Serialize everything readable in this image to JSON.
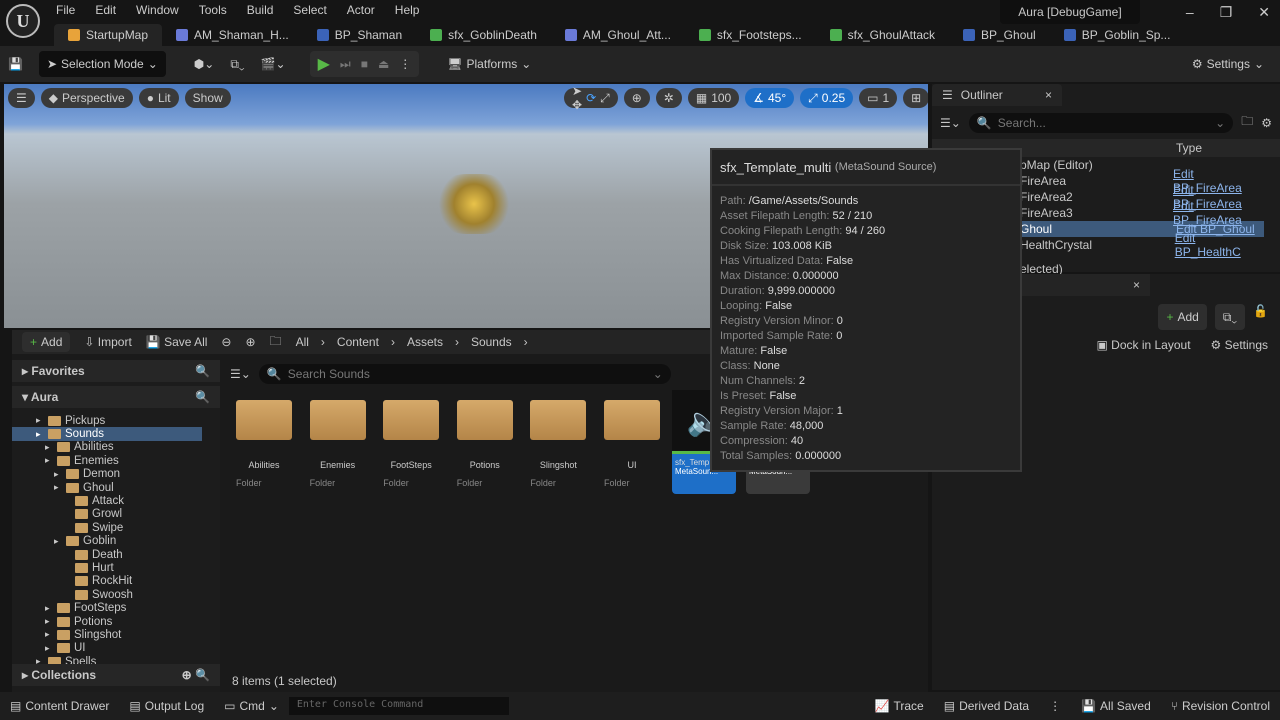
{
  "app": {
    "window_title": "Aura [DebugGame]",
    "menu": [
      "File",
      "Edit",
      "Window",
      "Tools",
      "Build",
      "Select",
      "Actor",
      "Help"
    ]
  },
  "tabs": [
    {
      "label": "StartupMap",
      "icon": "level-icon"
    },
    {
      "label": "AM_Shaman_H...",
      "icon": "anim-montage-icon"
    },
    {
      "label": "BP_Shaman",
      "icon": "blueprint-icon"
    },
    {
      "label": "sfx_GoblinDeath",
      "icon": "sound-icon"
    },
    {
      "label": "AM_Ghoul_Att...",
      "icon": "anim-montage-icon"
    },
    {
      "label": "sfx_Footsteps...",
      "icon": "sound-icon"
    },
    {
      "label": "sfx_GhoulAttack",
      "icon": "sound-icon"
    },
    {
      "label": "BP_Ghoul",
      "icon": "blueprint-icon"
    },
    {
      "label": "BP_Goblin_Sp...",
      "icon": "blueprint-icon"
    }
  ],
  "toolbar": {
    "selection_mode": "Selection Mode",
    "platforms": "Platforms",
    "settings": "Settings"
  },
  "viewport": {
    "perspective": "Perspective",
    "lit": "Lit",
    "show": "Show",
    "grid_snap": "100",
    "rot_snap": "45°",
    "scale_snap": "0.25",
    "camera_speed": "1"
  },
  "outliner": {
    "title": "Outliner",
    "search_placeholder": "Search...",
    "type_header": "Type",
    "rows": [
      {
        "label": "pMap (Editor)",
        "type": ""
      },
      {
        "label": "FireArea",
        "type": "Edit BP_FireArea"
      },
      {
        "label": "FireArea2",
        "type": "Edit BP_FireArea"
      },
      {
        "label": "FireArea3",
        "type": "Edit BP_FireArea"
      },
      {
        "label": "Ghoul",
        "type": "Edit BP_Ghoul",
        "selected": true
      },
      {
        "label": "HealthCrystal",
        "type": "Edit BP_HealthC"
      }
    ],
    "footer": "elected)"
  },
  "details": {
    "add": "Add",
    "dock": "Dock in Layout",
    "settings": "Settings"
  },
  "content_browser": {
    "add": "Add",
    "import": "Import",
    "save_all": "Save All",
    "breadcrumb": [
      "All",
      "Content",
      "Assets",
      "Sounds"
    ],
    "search_placeholder": "Search Sounds",
    "status": "8 items (1 selected)",
    "favorites": "Favorites",
    "root": "Aura",
    "collections": "Collections",
    "tree": [
      {
        "label": "Pickups",
        "depth": 2
      },
      {
        "label": "Sounds",
        "depth": 2,
        "selected": true
      },
      {
        "label": "Abilities",
        "depth": 3
      },
      {
        "label": "Enemies",
        "depth": 3
      },
      {
        "label": "Demon",
        "depth": 4
      },
      {
        "label": "Ghoul",
        "depth": 4
      },
      {
        "label": "Attack",
        "depth": 5
      },
      {
        "label": "Growl",
        "depth": 5
      },
      {
        "label": "Swipe",
        "depth": 5
      },
      {
        "label": "Goblin",
        "depth": 4
      },
      {
        "label": "Death",
        "depth": 5
      },
      {
        "label": "Hurt",
        "depth": 5
      },
      {
        "label": "RockHit",
        "depth": 5
      },
      {
        "label": "Swoosh",
        "depth": 5
      },
      {
        "label": "FootSteps",
        "depth": 3
      },
      {
        "label": "Potions",
        "depth": 3
      },
      {
        "label": "Slingshot",
        "depth": 3
      },
      {
        "label": "UI",
        "depth": 3
      },
      {
        "label": "Spells",
        "depth": 2
      }
    ],
    "items": [
      {
        "name": "Abilities",
        "type": "Folder"
      },
      {
        "name": "Enemies",
        "type": "Folder"
      },
      {
        "name": "FootSteps",
        "type": "Folder"
      },
      {
        "name": "Potions",
        "type": "Folder"
      },
      {
        "name": "Slingshot",
        "type": "Folder"
      },
      {
        "name": "UI",
        "type": "Folder"
      }
    ],
    "assets": [
      {
        "name": "sfx_Temp multi",
        "type": "MetaSoun...",
        "selected": true
      },
      {
        "name": "single",
        "type": "MetaSoun..."
      }
    ]
  },
  "tooltip": {
    "title": "sfx_Template_multi",
    "subtitle": "(MetaSound Source)",
    "props": [
      [
        "Path:",
        "/Game/Assets/Sounds"
      ],
      [
        "Asset Filepath Length:",
        "52 / 210"
      ],
      [
        "Cooking Filepath Length:",
        "94 / 260"
      ],
      [
        "Disk Size:",
        "103.008 KiB"
      ],
      [
        "Has Virtualized Data:",
        "False"
      ],
      [
        "Max Distance:",
        "0.000000"
      ],
      [
        "Duration:",
        "9,999.000000"
      ],
      [
        "Looping:",
        "False"
      ],
      [
        "Registry Version Minor:",
        "0"
      ],
      [
        "Imported Sample Rate:",
        "0"
      ],
      [
        "Mature:",
        "False"
      ],
      [
        "Class:",
        "None"
      ],
      [
        "Num Channels:",
        "2"
      ],
      [
        "Is Preset:",
        "False"
      ],
      [
        "Registry Version Major:",
        "1"
      ],
      [
        "Sample Rate:",
        "48,000"
      ],
      [
        "Compression:",
        "40"
      ],
      [
        "Total Samples:",
        "0.000000"
      ]
    ]
  },
  "statusbar": {
    "content_drawer": "Content Drawer",
    "output_log": "Output Log",
    "cmd": "Cmd",
    "console_placeholder": "Enter Console Command",
    "trace": "Trace",
    "derived_data": "Derived Data",
    "all_saved": "All Saved",
    "revision_control": "Revision Control"
  },
  "colors": {
    "accent": "#1e6fc8",
    "selected_row": "#3d5a7c",
    "play": "#58b947"
  }
}
